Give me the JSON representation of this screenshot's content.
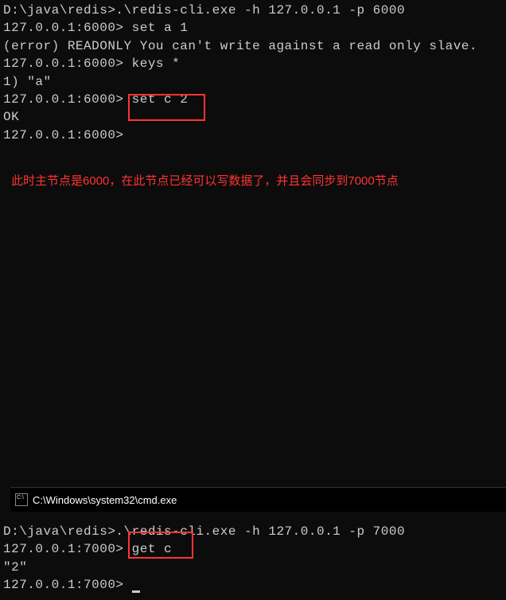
{
  "terminal_top": {
    "lines": [
      "D:\\java\\redis>.\\redis-cli.exe -h 127.0.0.1 -p 6000",
      "127.0.0.1:6000> set a 1",
      "(error) READONLY You can't write against a read only slave.",
      "127.0.0.1:6000> keys *",
      "1) \"a\"",
      "127.0.0.1:6000> set c 2",
      "OK",
      "127.0.0.1:6000>"
    ]
  },
  "annotation": "此时主节点是6000，在此节点已经可以写数据了，并且会同步到7000节点",
  "titlebar": {
    "text": "C:\\Windows\\system32\\cmd.exe"
  },
  "terminal_bottom": {
    "lines": [
      "D:\\java\\redis>.\\redis-cli.exe -h 127.0.0.1 -p 7000",
      "127.0.0.1:7000> get c",
      "\"2\"",
      "127.0.0.1:7000> "
    ]
  }
}
